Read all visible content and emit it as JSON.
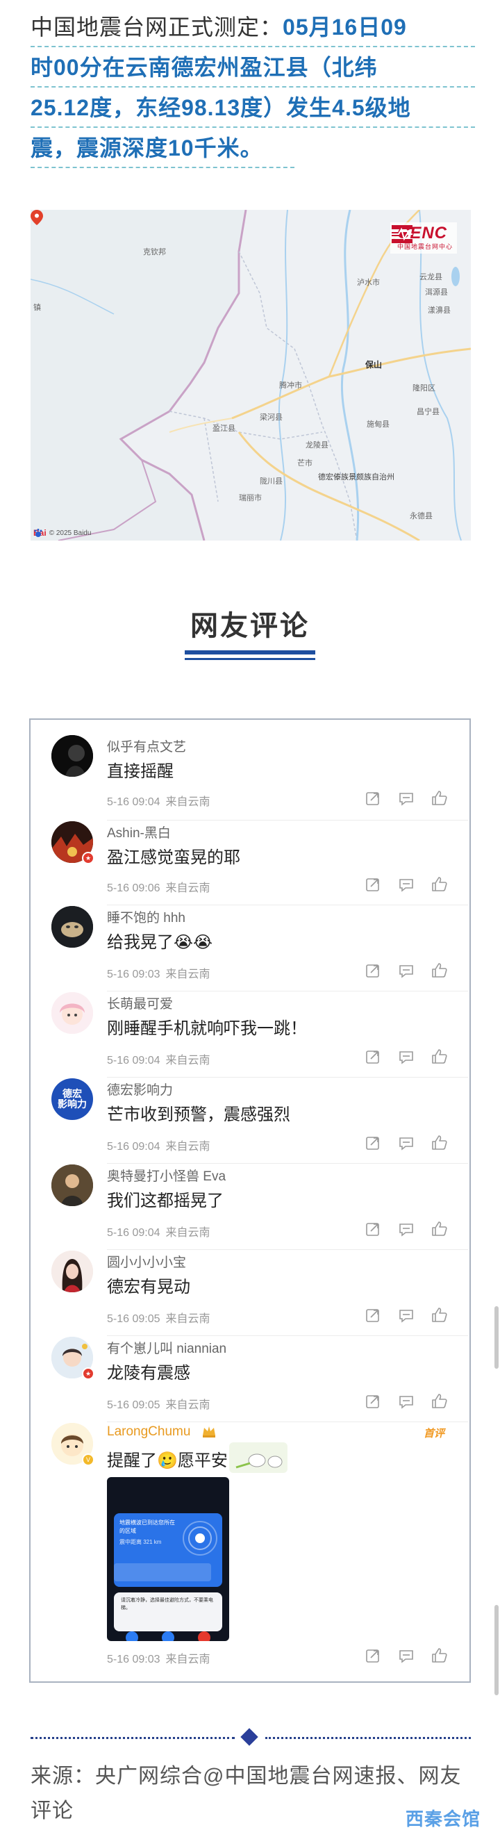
{
  "headline": {
    "line1_plain": "中国地震台网正式测定：",
    "line1_hl": "05月16日09",
    "line2_hl": "时00分在云南德宏州盈江县（北纬",
    "line3_hl": "25.12度，东经98.13度）发生4.5级地",
    "line4_hl": "震，震源深度10千米。"
  },
  "map": {
    "logo_title": "CENC",
    "logo_sub": "中国地震台网中心",
    "attribution": "© 2025 Baidu",
    "baidu_text": "Bai",
    "places": [
      "克钦邦",
      "泸水市",
      "云龙县",
      "洱源县",
      "漾濞县",
      "保山",
      "腾冲市",
      "梁河县",
      "盈江县",
      "施甸县",
      "龙陵县",
      "芒市",
      "德宏傣族景颇族自治州",
      "永德县",
      "瑞丽市",
      "陇川县",
      "隆阳区",
      "昌宁县",
      "镇"
    ]
  },
  "section_title": "网友评论",
  "comments": [
    {
      "user": "似乎有点文艺",
      "text": "直接摇醒",
      "time": "5-16 09:04",
      "loc": "来自云南"
    },
    {
      "user": "Ashin-黑白",
      "text": "盈江感觉蛮晃的耶",
      "time": "5-16 09:06",
      "loc": "来自云南"
    },
    {
      "user": "睡不饱的 hhh",
      "text": "给我晃了😭😭",
      "time": "5-16 09:03",
      "loc": "来自云南"
    },
    {
      "user": "长萌最可爱",
      "text": "刚睡醒手机就响吓我一跳！",
      "time": "5-16 09:04",
      "loc": "来自云南"
    },
    {
      "user": "德宏影响力",
      "text": "芒市收到预警，震感强烈",
      "time": "5-16 09:04",
      "loc": "来自云南"
    },
    {
      "user": "奥特曼打小怪兽 Eva",
      "text": "我们这都摇晃了",
      "time": "5-16 09:04",
      "loc": "来自云南"
    },
    {
      "user": "圆小小小小宝",
      "text": "德宏有晃动",
      "time": "5-16 09:05",
      "loc": "来自云南"
    },
    {
      "user": "有个崽儿叫 niannian",
      "text": "龙陵有震感",
      "time": "5-16 09:05",
      "loc": "来自云南"
    },
    {
      "user": "LarongChumu",
      "text": "提醒了🥲愿平安",
      "time": "5-16 09:03",
      "loc": "来自云南",
      "badge": "首评"
    }
  ],
  "avatar_labels": {
    "dehong": "德宏\n影响力"
  },
  "alert_screenshot": {
    "title": "地震横波已到达您所在的区域",
    "subtitle": "震中距离 321 km",
    "tip": "请沉着冷静，选择最佳避险方式，不要乘电梯。"
  },
  "footer": {
    "source": "来源：央广网综合@中国地震台网速报、网友评论",
    "watermark": "西秦会馆"
  }
}
